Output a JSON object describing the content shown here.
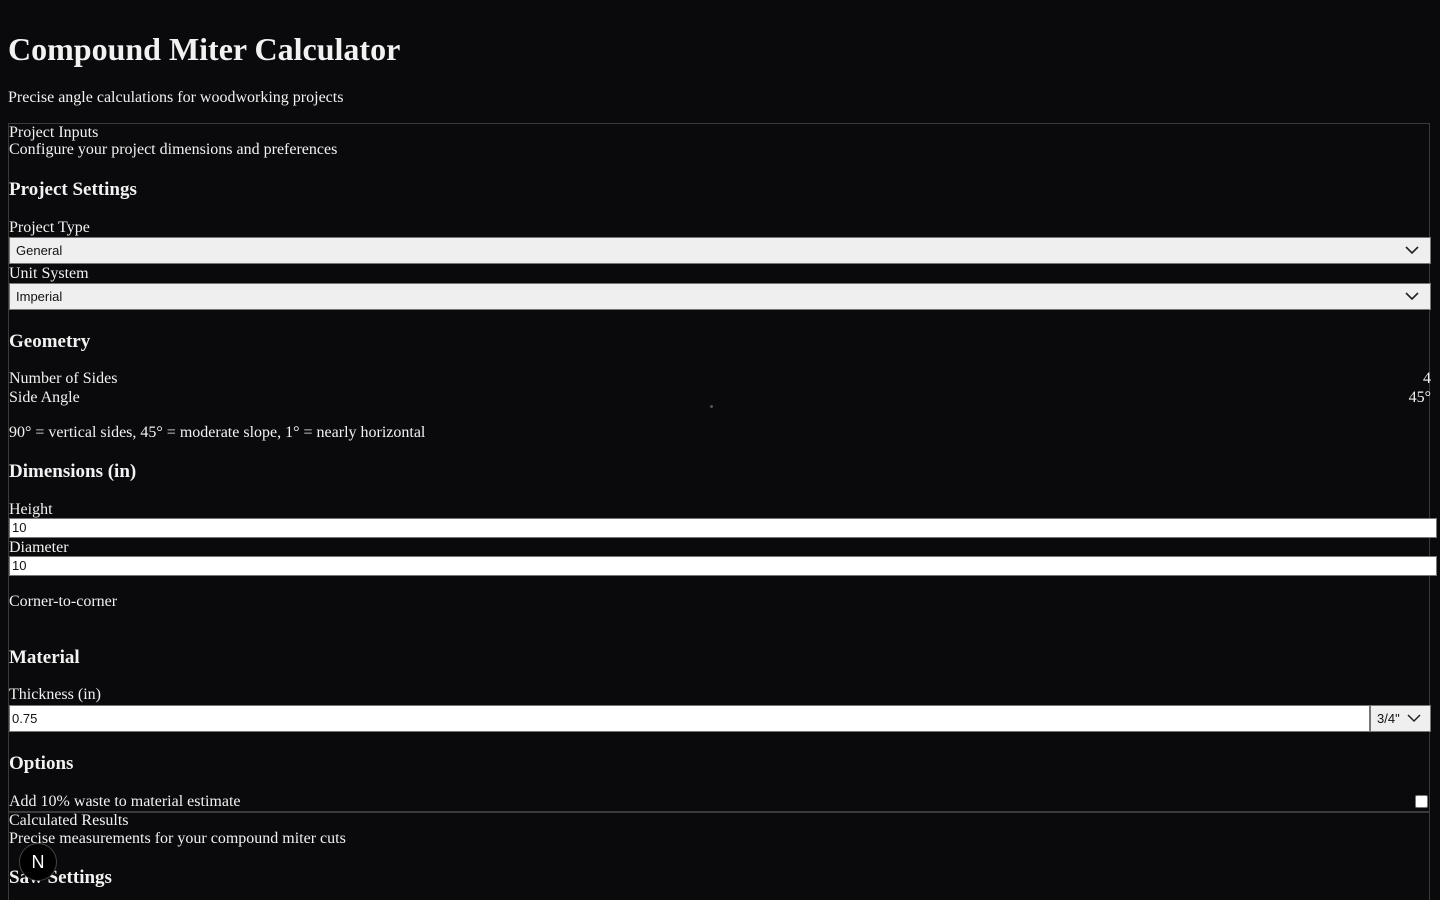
{
  "header": {
    "title": "Compound Miter Calculator",
    "subtitle": "Precise angle calculations for woodworking projects"
  },
  "inputs_card": {
    "title": "Project Inputs",
    "description": "Configure your project dimensions and preferences"
  },
  "project_settings": {
    "heading": "Project Settings",
    "project_type_label": "Project Type",
    "project_type_value": "General",
    "unit_system_label": "Unit System",
    "unit_system_value": "Imperial"
  },
  "geometry": {
    "heading": "Geometry",
    "sides_label": "Number of Sides",
    "sides_value": "4",
    "side_angle_label": "Side Angle",
    "side_angle_value": "45°",
    "hint": "90° = vertical sides, 45° = moderate slope, 1° = nearly horizontal"
  },
  "dimensions": {
    "heading": "Dimensions (in)",
    "height_label": "Height",
    "height_value": "10",
    "diameter_label": "Diameter",
    "diameter_value": "10",
    "diameter_mode": "Corner-to-corner"
  },
  "material": {
    "heading": "Material",
    "thickness_label": "Thickness (in)",
    "thickness_value": "0.75",
    "thickness_preset": "3/4\""
  },
  "options": {
    "heading": "Options",
    "waste_label": "Add 10% waste to material estimate"
  },
  "results_card": {
    "title": "Calculated Results",
    "description": "Precise measurements for your compound miter cuts",
    "saw_settings_heading": "Saw Settings"
  },
  "badge": {
    "letter": "N"
  }
}
